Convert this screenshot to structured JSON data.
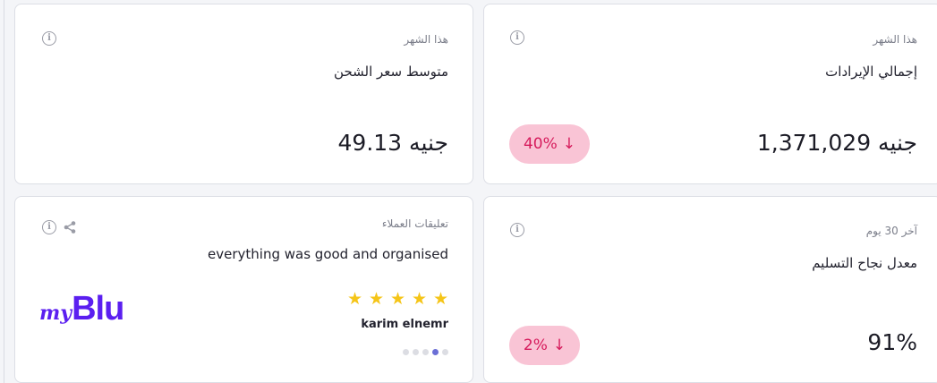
{
  "cards": {
    "shipping_avg": {
      "period": "هذا الشهر",
      "title": "متوسط سعر الشحن",
      "value": "49.13 جنيه"
    },
    "revenue": {
      "period": "هذا الشهر",
      "title": "إجمالي الإيرادات",
      "value": "1,371,029 جنيه",
      "change": "40%",
      "change_direction": "down"
    },
    "feedback": {
      "period": "تعليقات العملاء",
      "comment": "everything was good and organised",
      "rating": 5,
      "rating_max": 5,
      "reviewer": "karim elnemr",
      "page_index": 2,
      "page_count": 5,
      "logo_prefix": "my",
      "logo_main": "Blu"
    },
    "delivery_rate": {
      "period": "آخر 30 يوم",
      "title": "معدل نجاح التسليم",
      "value": "91%",
      "change": "2%",
      "change_direction": "down"
    }
  },
  "icons": {
    "info": "info-icon",
    "share": "share-icon",
    "arrow_down": "arrow-down-icon",
    "star": "star-icon"
  },
  "colors": {
    "badge_bg": "#f9c4d5",
    "badge_text": "#d61b5c",
    "star": "#f5c518",
    "brand": "#5b1ff0"
  }
}
